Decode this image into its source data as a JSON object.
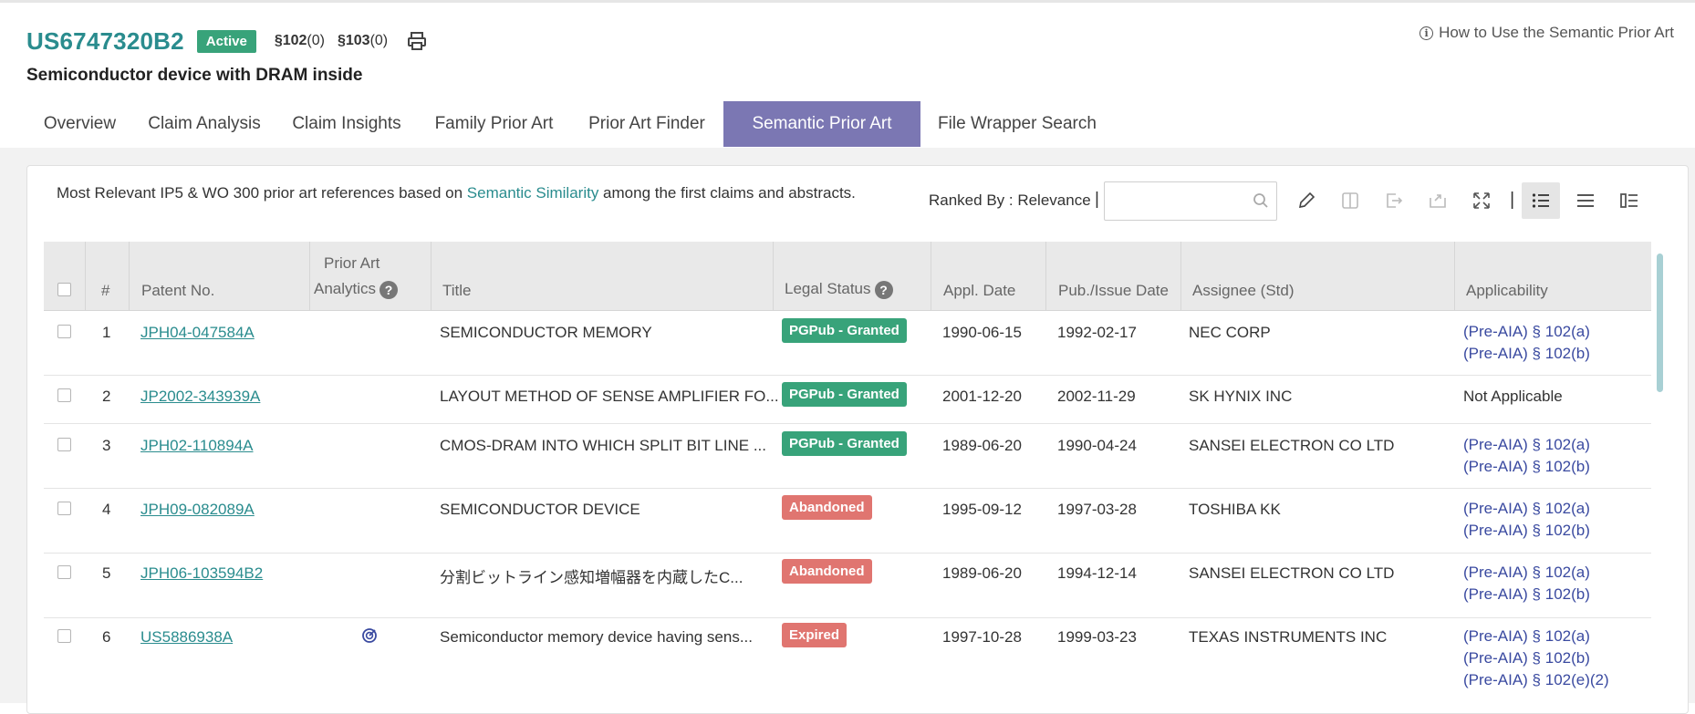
{
  "header": {
    "patent_number": "US6747320B2",
    "status_badge": "Active",
    "sec102_label": "§102",
    "sec102_count": "(0)",
    "sec103_label": "§103",
    "sec103_count": "(0)",
    "subtitle": "Semiconductor device with DRAM inside",
    "help_link": "How to Use the Semantic Prior Art"
  },
  "tabs": [
    {
      "label": "Overview"
    },
    {
      "label": "Claim Analysis"
    },
    {
      "label": "Claim Insights"
    },
    {
      "label": "Family Prior Art"
    },
    {
      "label": "Prior Art Finder"
    },
    {
      "label": "Semantic Prior Art",
      "active": true
    },
    {
      "label": "File Wrapper Search"
    }
  ],
  "toolbar": {
    "info_prefix": "Most Relevant IP5 & WO 300 prior art references based on ",
    "info_link": "Semantic Similarity",
    "info_suffix": " among the first claims and abstracts.",
    "ranked_by": "Ranked By : Relevance",
    "separator": "|",
    "search_value": ""
  },
  "table": {
    "headers": {
      "num": "#",
      "patent_no": "Patent No.",
      "prior_art_line1": "Prior Art",
      "prior_art_line2": "Analytics",
      "title": "Title",
      "legal_status": "Legal Status",
      "appl_date": "Appl. Date",
      "pub_date": "Pub./Issue Date",
      "assignee": "Assignee (Std)",
      "applicability": "Applicability"
    },
    "rows": [
      {
        "num": "1",
        "patent": "JPH04-047584A",
        "title": "SEMICONDUCTOR MEMORY",
        "status": "PGPub - Granted",
        "status_color": "#38a37a",
        "appl": "1990-06-15",
        "pub": "1992-02-17",
        "assignee": "NEC CORP",
        "app1": "(Pre-AIA) § 102(a)",
        "app2": "(Pre-AIA) § 102(b)",
        "app3": ""
      },
      {
        "num": "2",
        "patent": "JP2002-343939A",
        "title": "LAYOUT METHOD OF SENSE AMPLIFIER FO...",
        "status": "PGPub - Granted",
        "status_color": "#38a37a",
        "appl": "2001-12-20",
        "pub": "2002-11-29",
        "assignee": "SK HYNIX INC",
        "app_plain": "Not Applicable"
      },
      {
        "num": "3",
        "patent": "JPH02-110894A",
        "title": "CMOS-DRAM INTO WHICH SPLIT BIT LINE ...",
        "status": "PGPub - Granted",
        "status_color": "#38a37a",
        "appl": "1989-06-20",
        "pub": "1990-04-24",
        "assignee": "SANSEI ELECTRON CO LTD",
        "app1": "(Pre-AIA) § 102(a)",
        "app2": "(Pre-AIA) § 102(b)",
        "app3": ""
      },
      {
        "num": "4",
        "patent": "JPH09-082089A",
        "title": "SEMICONDUCTOR DEVICE",
        "status": "Abandoned",
        "status_color": "#e07570",
        "appl": "1995-09-12",
        "pub": "1997-03-28",
        "assignee": "TOSHIBA KK",
        "app1": "(Pre-AIA) § 102(a)",
        "app2": "(Pre-AIA) § 102(b)",
        "app3": ""
      },
      {
        "num": "5",
        "patent": "JPH06-103594B2",
        "title": "分割ビットライン感知増幅器を内蔵したC...",
        "status": "Abandoned",
        "status_color": "#e07570",
        "appl": "1989-06-20",
        "pub": "1994-12-14",
        "assignee": "SANSEI ELECTRON CO LTD",
        "app1": "(Pre-AIA) § 102(a)",
        "app2": "(Pre-AIA) § 102(b)",
        "app3": ""
      },
      {
        "num": "6",
        "patent": "US5886938A",
        "title": "Semiconductor memory device having sens...",
        "status": "Expired",
        "status_color": "#e07570",
        "appl": "1997-10-28",
        "pub": "1999-03-23",
        "assignee": "TEXAS INSTRUMENTS INC",
        "app1": "(Pre-AIA) § 102(a)",
        "app2": "(Pre-AIA) § 102(b)",
        "app3": "(Pre-AIA) § 102(e)(2)",
        "analytics_icon": "analytics-target-icon"
      }
    ]
  },
  "colors": {
    "brand_teal": "#2a8c8e",
    "active_tab": "#7b77b3",
    "granted": "#38a37a",
    "abandoned": "#e07570",
    "applicability_link": "#3a4aa0"
  }
}
